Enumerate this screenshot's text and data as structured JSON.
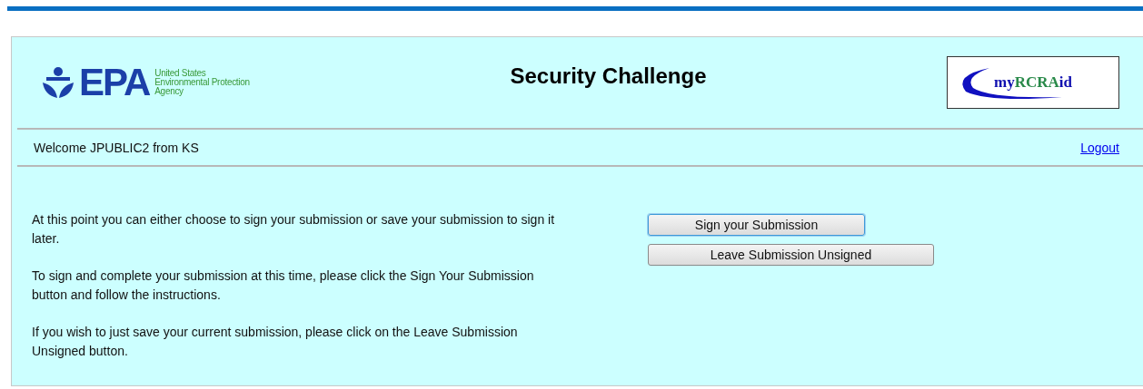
{
  "header": {
    "agency_logo": {
      "mark": "EPA",
      "lines": [
        "United States",
        "Environmental Protection",
        "Agency"
      ]
    },
    "title": "Security Challenge",
    "app_logo": {
      "prefix": "my",
      "core": "RCRA",
      "suffix": "id"
    }
  },
  "welcome_bar": {
    "greeting": "Welcome JPUBLIC2 from KS",
    "logout_link": "Logout"
  },
  "paragraphs": [
    "At this point you can either choose to sign your submission or save your submission to sign it later.",
    "To sign and complete your submission at this time, please click the Sign Your Submission button and follow the instructions.",
    "If you wish to just save your current submission, please click on the Leave Submission Unsigned button."
  ],
  "buttons": [
    {
      "label": "Sign your Submission",
      "focused": true
    },
    {
      "label": "Leave Submission Unsigned",
      "focused": false
    }
  ]
}
